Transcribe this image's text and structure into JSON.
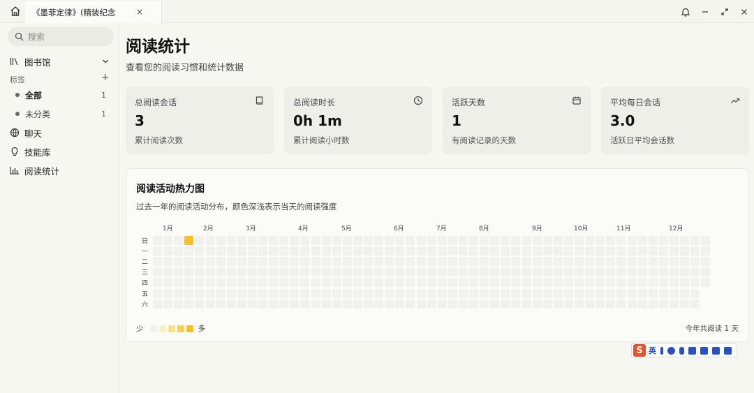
{
  "window": {
    "tab_title": "《墨菲定律》(精装纪念",
    "tab_close": "×"
  },
  "sidebar": {
    "search_placeholder": "搜索",
    "library_label": "图书馆",
    "tags_section": "标签",
    "tags_add": "+",
    "tags": [
      {
        "label": "全部",
        "count": "1",
        "bold": true
      },
      {
        "label": "未分类",
        "count": "1",
        "bold": false
      }
    ],
    "chat_label": "聊天",
    "skills_label": "技能库",
    "stats_label": "阅读统计"
  },
  "page": {
    "title": "阅读统计",
    "subtitle": "查看您的阅读习惯和统计数据"
  },
  "cards": [
    {
      "label": "总阅读会话",
      "value": "3",
      "desc": "累计阅读次数",
      "icon": "book-icon"
    },
    {
      "label": "总阅读时长",
      "value": "0h 1m",
      "desc": "累计阅读小时数",
      "icon": "clock-icon"
    },
    {
      "label": "活跃天数",
      "value": "1",
      "desc": "有阅读记录的天数",
      "icon": "calendar-icon"
    },
    {
      "label": "平均每日会话",
      "value": "3.0",
      "desc": "活跃日平均会话数",
      "icon": "trending-up-icon"
    }
  ],
  "heatmap": {
    "title": "阅读活动热力图",
    "subtitle": "过去一年的阅读活动分布，颜色深浅表示当天的阅读强度",
    "months": [
      "1月",
      "2月",
      "3月",
      "4月",
      "5月",
      "6月",
      "7月",
      "8月",
      "9月",
      "10月",
      "11月",
      "12月"
    ],
    "days": [
      "日",
      "一",
      "二",
      "三",
      "四",
      "五",
      "六"
    ],
    "active_week": 3,
    "active_day": 0,
    "legend_less": "少",
    "legend_more": "多",
    "legend_colors": [
      "#f1f1ee",
      "#fbefc4",
      "#fbe08a",
      "#f9d050",
      "#f6c026"
    ],
    "total": "今年共阅读 1 天"
  },
  "ime": {
    "logo": "S",
    "lang": "英"
  },
  "colors": {
    "accent": "#f6c026",
    "empty_cell": "#f1f1ee"
  }
}
